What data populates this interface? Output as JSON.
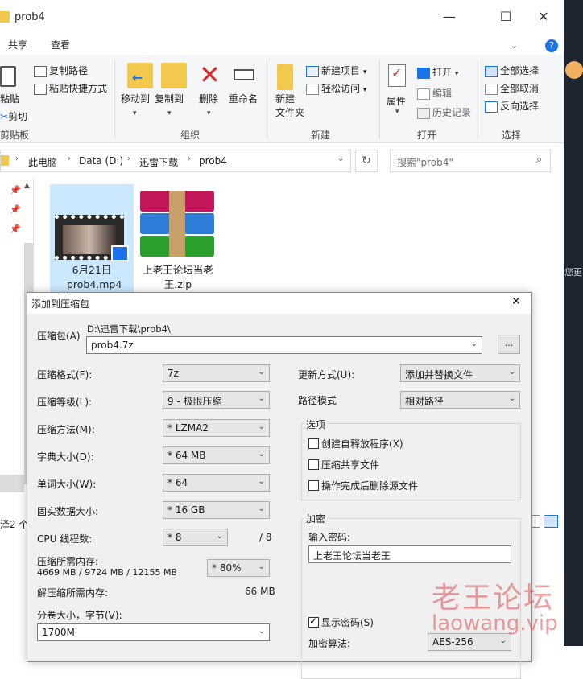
{
  "explorer": {
    "title": "prob4",
    "window_buttons": {
      "minimize": "—",
      "maximize": "☐",
      "close": "✕"
    },
    "ribbon_tabs": [
      "共享",
      "查看"
    ],
    "help": "?",
    "clipboard": {
      "paste": "粘贴",
      "copy_path": "复制路径",
      "paste_shortcut": "粘贴快捷方式",
      "cut": "剪切",
      "group": "剪贴板"
    },
    "organize": {
      "move_to": "移动到",
      "copy_to": "复制到",
      "delete": "删除",
      "rename": "重命名",
      "group": "组织"
    },
    "new": {
      "new_folder_l1": "新建",
      "new_folder_l2": "文件夹",
      "new_item": "新建项目",
      "easy_access": "轻松访问",
      "group": "新建"
    },
    "open": {
      "properties": "属性",
      "open": "打开",
      "edit": "编辑",
      "history": "历史记录",
      "group": "打开"
    },
    "select": {
      "select_all": "全部选择",
      "select_none": "全部取消",
      "invert": "反向选择",
      "group": "选择"
    },
    "breadcrumb": [
      "此电脑",
      "Data (D:)",
      "迅雷下载",
      "prob4"
    ],
    "search_placeholder": "搜索\"prob4\"",
    "files": [
      {
        "name_l1": "6月21日",
        "name_l2": "_prob4.mp4"
      },
      {
        "name_l1": "上老王论坛当老",
        "name_l2": "王.zip"
      }
    ],
    "status": "2 个",
    "status_prefix": "泽"
  },
  "right_strip_text": "您更",
  "dialog": {
    "title": "添加到压缩包",
    "close": "✕",
    "archive_label": "压缩包(A)",
    "archive_path": "D:\\迅雷下载\\prob4\\",
    "archive_name": "prob4.7z",
    "browse": "...",
    "format_label": "压缩格式(F):",
    "format_value": "7z",
    "level_label": "压缩等级(L):",
    "level_value": "9 - 极限压缩",
    "method_label": "压缩方法(M):",
    "method_value": "* LZMA2",
    "dict_label": "字典大小(D):",
    "dict_value": "* 64 MB",
    "word_label": "单词大小(W):",
    "word_value": "* 64",
    "solid_label": "固实数据大小:",
    "solid_value": "* 16 GB",
    "cpu_label": "CPU 线程数:",
    "cpu_value": "* 8",
    "cpu_max": "/ 8",
    "mem_label": "压缩所需内存:",
    "mem_values": "4669 MB / 9724 MB / 12155 MB",
    "mem_percent": "* 80%",
    "decomp_label": "解压缩所需内存:",
    "decomp_value": "66 MB",
    "split_label": "分卷大小，字节(V):",
    "split_value": "1700M",
    "update_label": "更新方式(U):",
    "update_value": "添加并替换文件",
    "path_label": "路径模式",
    "path_value": "相对路径",
    "options_title": "选项",
    "opt_sfx": "创建自释放程序(X)",
    "opt_shared": "压缩共享文件",
    "opt_delete": "操作完成后删除源文件",
    "enc_title": "加密",
    "password_label": "输入密码:",
    "password_value": "上老王论坛当老王",
    "show_password": "显示密码(S)",
    "enc_method_label": "加密算法:",
    "enc_method_value": "AES-256"
  },
  "watermark": {
    "cn": "老王论坛",
    "en": "laowang.vip"
  }
}
